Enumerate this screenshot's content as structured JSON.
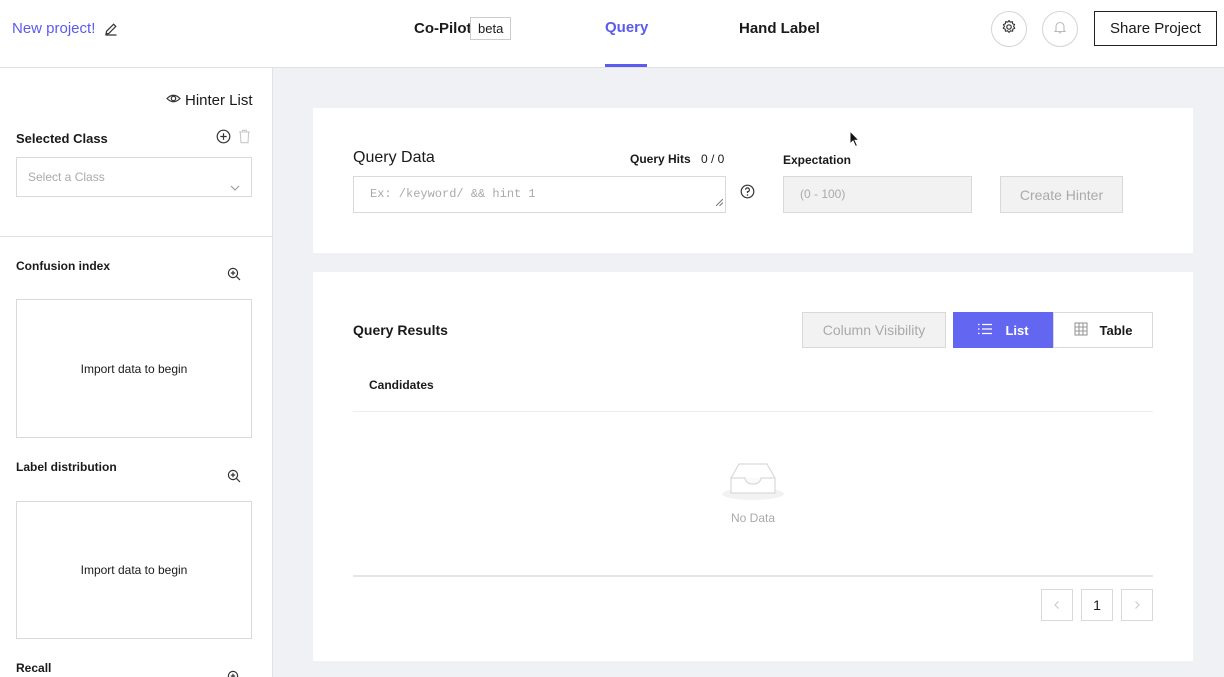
{
  "header": {
    "project_name": "New project!",
    "nav_copilot": "Co-Pilot",
    "beta_badge": "beta",
    "nav_query": "Query",
    "nav_hand_label": "Hand Label",
    "share_button": "Share Project",
    "accent_color": "#5b5bf0"
  },
  "sidebar": {
    "hinter_list": "Hinter List",
    "selected_class_label": "Selected Class",
    "class_placeholder": "Select a Class",
    "sections": [
      {
        "title": "Confusion index",
        "empty_text": "Import data to begin"
      },
      {
        "title": "Label distribution",
        "empty_text": "Import data to begin"
      },
      {
        "title": "Recall"
      }
    ]
  },
  "query_data": {
    "label": "Query Data",
    "query_hits_label": "Query Hits",
    "query_hits_value": "0 / 0",
    "placeholder": "Ex: /keyword/ && hint 1",
    "expectation_label": "Expectation",
    "expectation_placeholder": "(0 - 100)",
    "create_button": "Create Hinter"
  },
  "query_results": {
    "label": "Query Results",
    "column_visibility": "Column Visibility",
    "list_button": "List",
    "table_button": "Table",
    "candidates_header": "Candidates",
    "no_data": "No Data",
    "current_page": "1"
  }
}
